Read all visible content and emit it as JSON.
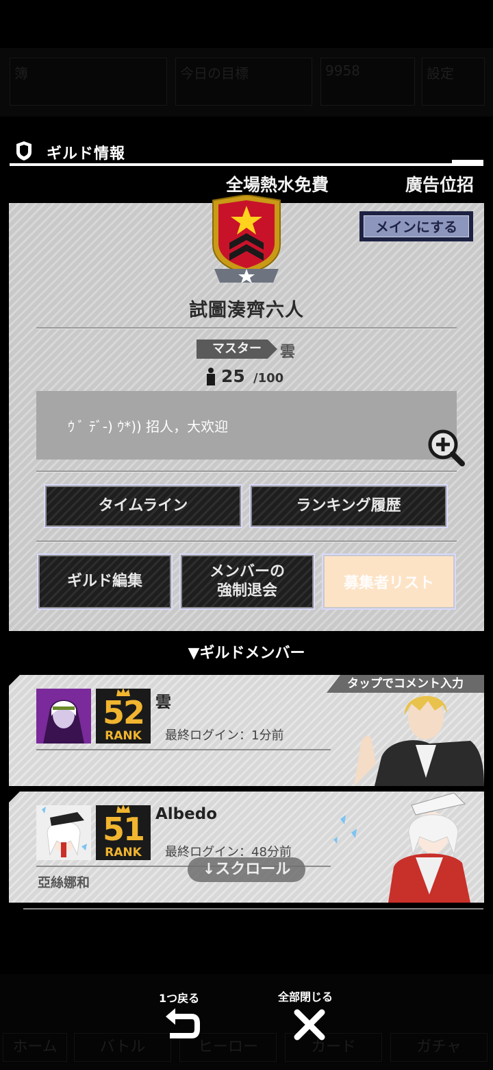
{
  "background_bar": {
    "items": [
      "簿",
      "今日の目標",
      "9958",
      "設定"
    ]
  },
  "background_tabs": [
    "ホーム",
    "バトル",
    "ヒーロー",
    "カード",
    "ガチャ"
  ],
  "header": {
    "title": "ギルド情報",
    "ticker": [
      "全場熱水免費",
      "廣告位招"
    ]
  },
  "guild": {
    "main_button": "メインにする",
    "name": "試圖湊齊六人",
    "master_label": "マスター",
    "master_name": "雲",
    "member_count": "25",
    "member_max": "/100",
    "comment": "ｳ ﾞ ﾃﾞ-) ｳ*)) 招人，大欢迎",
    "buttons": {
      "timeline": "タイムライン",
      "ranking_history": "ランキング履歴",
      "guild_edit": "ギルド編集",
      "force_leave": "メンバーの\n強制退会",
      "applicant_list": "募集者リスト"
    }
  },
  "members_section": {
    "title": "▼ギルドメンバー",
    "tap_hint": "タップでコメント入力",
    "members": [
      {
        "name": "雲",
        "rank": "52",
        "rank_word": "RANK",
        "last_login": "最終ログイン：1分前",
        "comment": ""
      },
      {
        "name": "Albedo",
        "rank": "51",
        "rank_word": "RANK",
        "last_login": "最終ログイン：48分前",
        "comment": "亞絲娜和"
      }
    ],
    "scroll_hint": "↓スクロール"
  },
  "footer": {
    "back_label": "1つ戻る",
    "close_label": "全部閉じる"
  },
  "colors": {
    "panel": "#c9c9c9",
    "rank_gold": "#f1b530",
    "main_button_bg": "#8d96bd",
    "applicant_button_bg": "#fde3c6"
  }
}
